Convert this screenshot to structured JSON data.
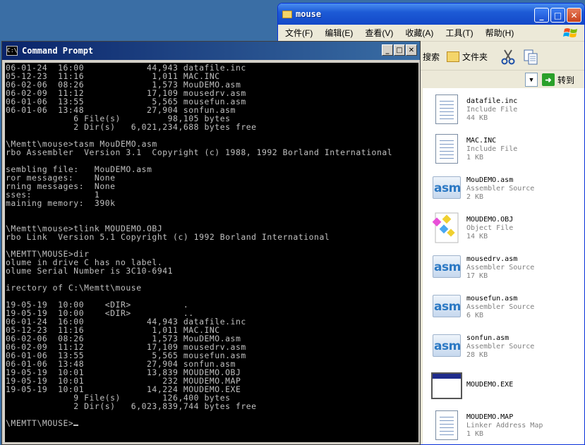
{
  "explorer": {
    "title": "mouse",
    "menu": [
      "文件(F)",
      "编辑(E)",
      "查看(V)",
      "收藏(A)",
      "工具(T)",
      "帮助(H)"
    ],
    "toolbar": {
      "search": "搜索",
      "folders": "文件夹"
    },
    "address": {
      "go": "转到"
    },
    "files": [
      {
        "name": "datafile.inc",
        "type": "Include File",
        "size": "44 KB",
        "icon": "document-icon"
      },
      {
        "name": "MAC.INC",
        "type": "Include File",
        "size": "1 KB",
        "icon": "document-icon"
      },
      {
        "name": "MouDEMO.asm",
        "type": "Assembler Source",
        "size": "2 KB",
        "icon": "asm-icon"
      },
      {
        "name": "MOUDEMO.OBJ",
        "type": "Object File",
        "size": "14 KB",
        "icon": "object-file-icon"
      },
      {
        "name": "mousedrv.asm",
        "type": "Assembler Source",
        "size": "17 KB",
        "icon": "asm-icon"
      },
      {
        "name": "mousefun.asm",
        "type": "Assembler Source",
        "size": "6 KB",
        "icon": "asm-icon"
      },
      {
        "name": "sonfun.asm",
        "type": "Assembler Source",
        "size": "28 KB",
        "icon": "asm-icon"
      },
      {
        "name": "MOUDEMO.EXE",
        "type": "",
        "size": "",
        "icon": "exe-icon"
      },
      {
        "name": "MOUDEMO.MAP",
        "type": "Linker Address Map",
        "size": "1 KB",
        "icon": "document-icon"
      }
    ],
    "asm_label": "asm"
  },
  "cmd": {
    "title": "Command Prompt",
    "icon_label": "C:\\",
    "lines": [
      "06-01-24  16:00            44,943 datafile.inc",
      "05-12-23  11:16             1,011 MAC.INC",
      "06-02-06  08:26             1,573 MouDEMO.asm",
      "06-02-09  11:12            17,109 mousedrv.asm",
      "06-01-06  13:55             5,565 mousefun.asm",
      "06-01-06  13:48            27,904 sonfun.asm",
      "             6 File(s)         98,105 bytes",
      "             2 Dir(s)   6,021,234,688 bytes free",
      "",
      "\\Memtt\\mouse>tasm MouDEMO.asm",
      "rbo Assembler  Version 3.1  Copyright (c) 1988, 1992 Borland International",
      "",
      "sembling file:   MouDEMO.asm",
      "ror messages:    None",
      "rning messages:  None",
      "sses:            1",
      "maining memory:  390k",
      "",
      "",
      "\\Memtt\\mouse>tlink MOUDEMO.OBJ",
      "rbo Link  Version 5.1 Copyright (c) 1992 Borland International",
      "",
      "\\MEMTT\\MOUSE>dir",
      "olume in drive C has no label.",
      "olume Serial Number is 3C10-6941",
      "",
      "irectory of C:\\Memtt\\mouse",
      "",
      "19-05-19  10:00    <DIR>          .",
      "19-05-19  10:00    <DIR>          ..",
      "06-01-24  16:00            44,943 datafile.inc",
      "05-12-23  11:16             1,011 MAC.INC",
      "06-02-06  08:26             1,573 MouDEMO.asm",
      "06-02-09  11:12            17,109 mousedrv.asm",
      "06-01-06  13:55             5,565 mousefun.asm",
      "06-01-06  13:48            27,904 sonfun.asm",
      "19-05-19  10:01            13,839 MOUDEMO.OBJ",
      "19-05-19  10:01               232 MOUDEMO.MAP",
      "19-05-19  10:01            14,224 MOUDEMO.EXE",
      "             9 File(s)        126,400 bytes",
      "             2 Dir(s)   6,023,839,744 bytes free",
      "",
      "\\MEMTT\\MOUSE>"
    ]
  }
}
